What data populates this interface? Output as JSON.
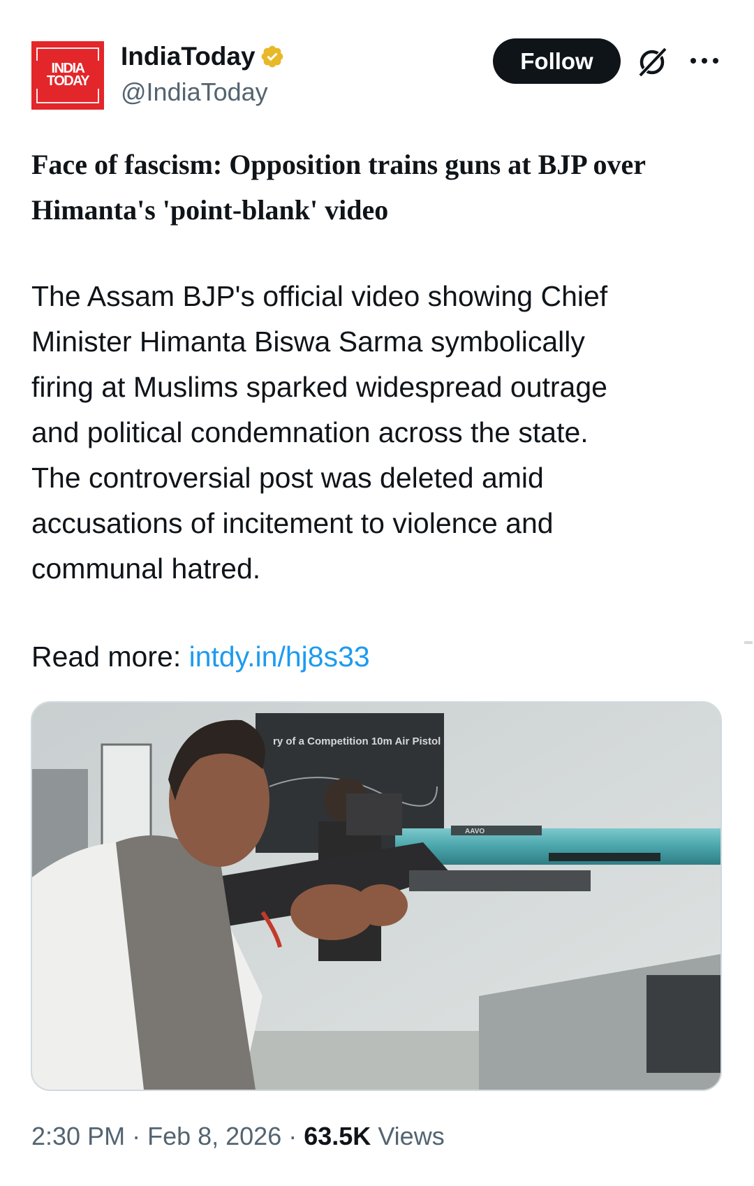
{
  "account": {
    "logo_line1": "INDIA",
    "logo_line2": "TODAY",
    "name": "IndiaToday",
    "handle": "@IndiaToday",
    "verified_icon": "gold-verified-badge-icon",
    "brand_color": "#e3262a",
    "verified_color": "#e8b829"
  },
  "actions": {
    "follow_label": "Follow",
    "grok_icon": "grok-icon",
    "more_icon": "more-dots-icon"
  },
  "post": {
    "headline_lines": [
      "Face of fascism: Opposition trains guns at BJP over",
      "Himanta's 'point-blank' video"
    ],
    "body_lines": [
      "The Assam BJP's official video showing Chief",
      "Minister Himanta Biswa Sarma symbolically",
      "firing at Muslims sparked widespread outrage",
      "and political condemnation across the state.",
      "The controversial post was deleted amid",
      "accusations of incitement to violence and",
      "communal hatred."
    ],
    "read_more_label": "Read more: ",
    "read_more_link": "intdy.in/hj8s33",
    "link_color": "#1d9bf0",
    "media": {
      "poster_text": "ry of a Competition 10m Air Pistol",
      "rifle_brand": "AAVO"
    }
  },
  "meta": {
    "time": "2:30 PM",
    "separator": " · ",
    "date": "Feb 8, 2026",
    "views_count": "63.5K",
    "views_label": " Views"
  }
}
